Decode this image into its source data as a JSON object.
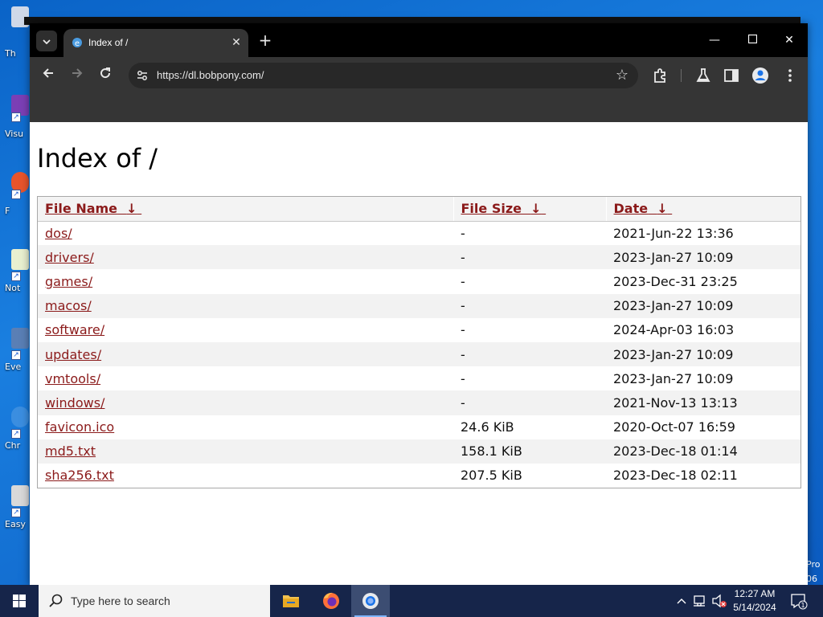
{
  "desktop": {
    "icons": [
      {
        "label": "Th"
      },
      {
        "label": "Visu"
      },
      {
        "label": "F"
      },
      {
        "label": "Not"
      },
      {
        "label": "Eve"
      },
      {
        "label": "Chr"
      },
      {
        "label": "Easy"
      }
    ],
    "edition_lines": [
      "Pro",
      "06"
    ]
  },
  "browser": {
    "tab": {
      "title": "Index of /"
    },
    "address": {
      "url": "https://dl.bobpony.com/"
    }
  },
  "page": {
    "heading": "Index of /",
    "columns": [
      {
        "label": "File Name",
        "sort": "↓"
      },
      {
        "label": "File Size",
        "sort": "↓"
      },
      {
        "label": "Date",
        "sort": "↓"
      }
    ],
    "rows": [
      {
        "name": "dos/",
        "size": "-",
        "date": "2021-Jun-22 13:36"
      },
      {
        "name": "drivers/",
        "size": "-",
        "date": "2023-Jan-27 10:09"
      },
      {
        "name": "games/",
        "size": "-",
        "date": "2023-Dec-31 23:25"
      },
      {
        "name": "macos/",
        "size": "-",
        "date": "2023-Jan-27 10:09"
      },
      {
        "name": "software/",
        "size": "-",
        "date": "2024-Apr-03 16:03"
      },
      {
        "name": "updates/",
        "size": "-",
        "date": "2023-Jan-27 10:09"
      },
      {
        "name": "vmtools/",
        "size": "-",
        "date": "2023-Jan-27 10:09"
      },
      {
        "name": "windows/",
        "size": "-",
        "date": "2021-Nov-13 13:13"
      },
      {
        "name": "favicon.ico",
        "size": "24.6 KiB",
        "date": "2020-Oct-07 16:59"
      },
      {
        "name": "md5.txt",
        "size": "158.1 KiB",
        "date": "2023-Dec-18 01:14"
      },
      {
        "name": "sha256.txt",
        "size": "207.5 KiB",
        "date": "2023-Dec-18 02:11"
      }
    ]
  },
  "taskbar": {
    "search_placeholder": "Type here to search",
    "apps": [
      "file-explorer-icon",
      "firefox-icon",
      "chrome-icon"
    ],
    "clock": {
      "time": "12:27 AM",
      "date": "5/14/2024"
    },
    "notification_count": "1"
  },
  "colors": {
    "link": "#8b1a1a",
    "chrome_dark": "#353535",
    "taskbar": "#16254a"
  }
}
